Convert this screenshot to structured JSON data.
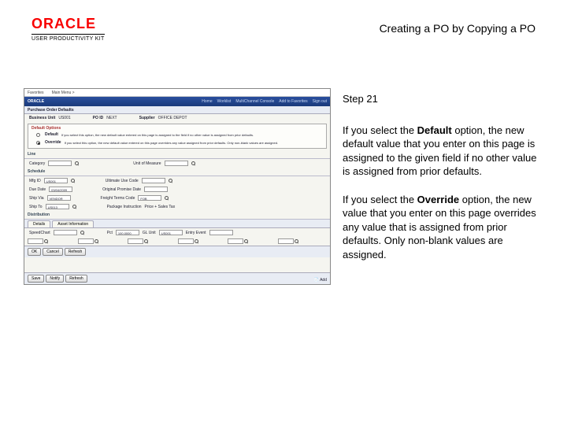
{
  "header": {
    "brand": "ORACLE",
    "product": "USER PRODUCTIVITY KIT",
    "title": "Creating a PO by Copying a PO"
  },
  "instructions": {
    "step_label": "Step 21",
    "p1a": "If you select the ",
    "p1b": "Default",
    "p1c": " option, the new default value that you enter on this page is assigned to the given field if no other value is assigned from prior defaults.",
    "p2a": "If you select the ",
    "p2b": "Override",
    "p2c": " option, the new value that you enter on this page overrides any value that is assigned from prior defaults. Only non-blank values are assigned."
  },
  "screenshot": {
    "oracle_header": "ORACLE",
    "header_links": [
      "Home",
      "Worklist",
      "MultiChannel Console",
      "Add to Favorites",
      "Sign out"
    ],
    "page_title_bar": "Purchase Order Defaults",
    "bu_label": "Business Unit",
    "bu_value": "US001",
    "poid_label": "PO ID",
    "poid_value": "NEXT",
    "supplier_label": "Supplier",
    "supplier_value": "OFFICE DEPOT",
    "default_options_h": "Default Options",
    "default_radio_desc": "If you select this option, the new default value entered on this page is assigned to the field if no other value is assigned from prior defaults.",
    "override_radio_desc": "If you select this option, the new default value entered on this page overrides any value assigned from prior defaults. Only non-blank values are assigned.",
    "default_label": "Default",
    "override_label": "Override",
    "line_h": "Line",
    "category_label": "Category",
    "uom_label": "Unit of Measure",
    "schedule_h": "Schedule",
    "mfg_label": "Mfg ID",
    "mfg_value": "US001",
    "ultimate_label": "Ultimate Use Code",
    "duedate_label": "Due Date",
    "duedate_value": "03/04/2009",
    "origprom_label": "Original Promise Date",
    "shipvia_label": "Ship Via",
    "shipvia_value": "VENDOR",
    "freight_label": "Freight Terms Code",
    "freight_value": "FOB",
    "shipto_label": "Ship To",
    "shipto_value": "US013",
    "pkg_label": "Package Instruction",
    "pkg_value": "Price + Sales Tax",
    "distribution_h": "Distribution",
    "tab_details": "Details",
    "tab_asset": "Asset Information",
    "speedchart_label": "SpeedChart",
    "pct_label": "Pct",
    "pct_value": "100.0000",
    "glunit_label": "GL Unit",
    "glunit_value": "US001",
    "entry_label": "Entry Event",
    "ok_btn": "OK",
    "cancel_btn": "Cancel",
    "refresh_btn": "Refresh",
    "save_btn": "Save",
    "notify_btn": "Notify",
    "refresh2_btn": "Refresh",
    "add_btn": "Add"
  }
}
